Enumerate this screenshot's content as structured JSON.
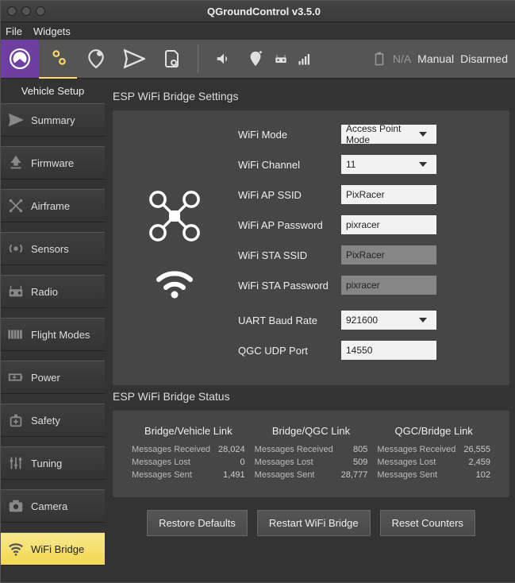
{
  "window": {
    "title": "QGroundControl v3.5.0"
  },
  "menu": {
    "file": "File",
    "widgets": "Widgets"
  },
  "toolbar_right": {
    "battery_na": "N/A",
    "mode": "Manual",
    "armed": "Disarmed"
  },
  "sidebar": {
    "title": "Vehicle Setup",
    "items": {
      "summary": "Summary",
      "firmware": "Firmware",
      "airframe": "Airframe",
      "sensors": "Sensors",
      "radio": "Radio",
      "flight_modes": "Flight Modes",
      "power": "Power",
      "safety": "Safety",
      "tuning": "Tuning",
      "camera": "Camera",
      "wifi_bridge": "WiFi Bridge"
    }
  },
  "settings": {
    "title": "ESP WiFi Bridge Settings",
    "fields": {
      "wifi_mode": {
        "label": "WiFi Mode",
        "value": "Access Point Mode"
      },
      "wifi_channel": {
        "label": "WiFi Channel",
        "value": "11"
      },
      "wifi_ap_ssid": {
        "label": "WiFi AP SSID",
        "value": "PixRacer"
      },
      "wifi_ap_password": {
        "label": "WiFi AP Password",
        "value": "pixracer"
      },
      "wifi_sta_ssid": {
        "label": "WiFi STA SSID",
        "value": "PixRacer"
      },
      "wifi_sta_password": {
        "label": "WiFi STA Password",
        "value": "pixracer"
      },
      "uart_baud": {
        "label": "UART Baud Rate",
        "value": "921600"
      },
      "qgc_udp": {
        "label": "QGC UDP Port",
        "value": "14550"
      }
    }
  },
  "status": {
    "title": "ESP WiFi Bridge Status",
    "labels": {
      "received": "Messages Received",
      "lost": "Messages Lost",
      "sent": "Messages Sent"
    },
    "cols": {
      "vehicle": {
        "title": "Bridge/Vehicle Link",
        "received": "28,024",
        "lost": "0",
        "sent": "1,491"
      },
      "qgc": {
        "title": "Bridge/QGC Link",
        "received": "805",
        "lost": "509",
        "sent": "28,777"
      },
      "bridge": {
        "title": "QGC/Bridge Link",
        "received": "26,555",
        "lost": "2,459",
        "sent": "102"
      }
    }
  },
  "buttons": {
    "restore": "Restore Defaults",
    "restart": "Restart WiFi Bridge",
    "reset": "Reset Counters"
  }
}
